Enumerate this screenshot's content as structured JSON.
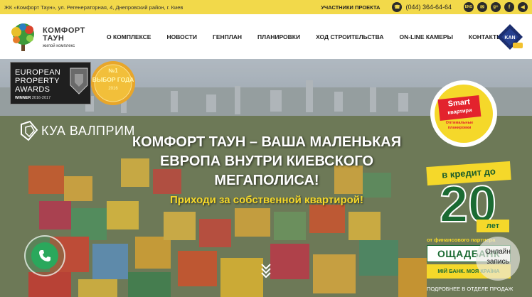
{
  "topbar": {
    "address": "ЖК «Комфорт Таун», ул. Регенераторная, 4, Днепровский район, г. Киев",
    "participants": "УЧАСТНИКИ ПРОЕКТА",
    "phone": "(044) 364-64-64",
    "lang": "ENG",
    "icons": [
      "phone-icon",
      "language-icon",
      "mail-icon",
      "google-plus-icon",
      "facebook-icon",
      "sound-icon"
    ]
  },
  "logo": {
    "line1": "КОМФОРТ",
    "line2": "ТАУН",
    "line3": "жилой комплекс"
  },
  "nav": [
    {
      "label": "О КОМПЛЕКСЕ"
    },
    {
      "label": "НОВОСТИ"
    },
    {
      "label": "ГЕНПЛАН"
    },
    {
      "label": "ПЛАНИРОВКИ"
    },
    {
      "label": "ХОД СТРОИТЕЛЬСТВА"
    },
    {
      "label": "ON-LINE КАМЕРЫ"
    },
    {
      "label": "КОНТАКТЫ"
    }
  ],
  "kan_logo": "KAN",
  "award": {
    "line1": "EUROPEAN",
    "line2": "PROPERTY",
    "line3": "AWARDS",
    "winner": "WINNER",
    "years": "2016-2017"
  },
  "medal": {
    "line1": "ВЫБОР ГОДА",
    "year": "2016"
  },
  "developer": "КУА ВАЛПРИМ",
  "hero": {
    "headline": "КОМФОРТ ТАУН – ВАША МАЛЕНЬКАЯ ЕВРОПА ВНУТРИ КИЕВСКОГО МЕГАПОЛИСА!",
    "sub": "Приходи за собственной квартирой!"
  },
  "smart": {
    "line1": "Smart",
    "line2": "квартири",
    "line3": "Оптимальные планировки"
  },
  "credit": {
    "label": "в кредит до",
    "number": "20",
    "years": "лет",
    "from": "от финансового партнера",
    "bank": "ОЩАДБАНК",
    "slogan": "МІЙ БАНК. МОЯ КРАЇНА",
    "details": "ПОДРОБНЕЕ В ОТДЕЛЕ ПРОДАЖ"
  },
  "online_request": "Онлайн запись",
  "colors": {
    "accent_yellow": "#f2d94a",
    "brand_green": "#1b6b33",
    "phone_green": "#2aa85c",
    "smart_red": "#e3232d"
  }
}
